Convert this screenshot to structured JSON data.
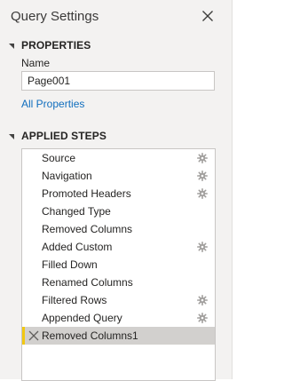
{
  "pane": {
    "title": "Query Settings"
  },
  "properties": {
    "heading": "PROPERTIES",
    "name_label": "Name",
    "name_value": "Page001",
    "all_properties_link": "All Properties"
  },
  "applied_steps": {
    "heading": "APPLIED STEPS",
    "items": [
      {
        "label": "Source",
        "has_settings": true,
        "selected": false
      },
      {
        "label": "Navigation",
        "has_settings": true,
        "selected": false
      },
      {
        "label": "Promoted Headers",
        "has_settings": true,
        "selected": false
      },
      {
        "label": "Changed Type",
        "has_settings": false,
        "selected": false
      },
      {
        "label": "Removed Columns",
        "has_settings": false,
        "selected": false
      },
      {
        "label": "Added Custom",
        "has_settings": true,
        "selected": false
      },
      {
        "label": "Filled Down",
        "has_settings": false,
        "selected": false
      },
      {
        "label": "Renamed Columns",
        "has_settings": false,
        "selected": false
      },
      {
        "label": "Filtered Rows",
        "has_settings": true,
        "selected": false
      },
      {
        "label": "Appended Query",
        "has_settings": true,
        "selected": false
      },
      {
        "label": "Removed Columns1",
        "has_settings": false,
        "selected": true
      }
    ]
  },
  "icons": {
    "close": "close-icon",
    "collapse": "collapse-triangle-icon",
    "settings": "gear-icon",
    "delete": "delete-step-icon"
  },
  "colors": {
    "link": "#106ebe",
    "selected_row": "#d2d0ce",
    "selected_accent": "#f2c811"
  }
}
